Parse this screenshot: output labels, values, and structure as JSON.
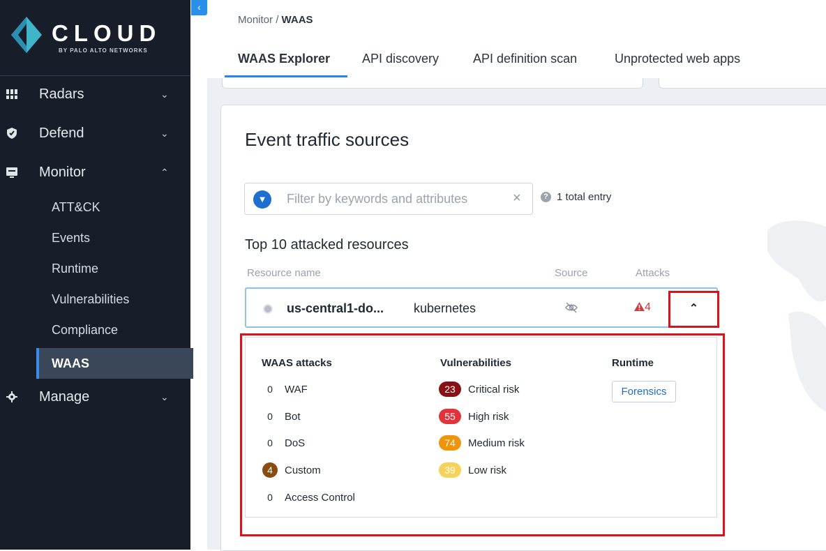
{
  "sidebar": {
    "logo_text": "CLOUD",
    "logo_sub": "BY PALO ALTO NETWORKS",
    "items": [
      {
        "label": "Radars",
        "icon": "radar-icon",
        "expanded": false
      },
      {
        "label": "Defend",
        "icon": "shield-icon",
        "expanded": false
      },
      {
        "label": "Monitor",
        "icon": "monitor-icon",
        "expanded": true
      },
      {
        "label": "Manage",
        "icon": "gear-icon",
        "expanded": false
      }
    ],
    "sub_items": [
      "ATT&CK",
      "Events",
      "Runtime",
      "Vulnerabilities",
      "Compliance",
      "WAAS"
    ],
    "active_sub": "WAAS"
  },
  "breadcrumb": {
    "parent": "Monitor",
    "separator": " / ",
    "current": "WAAS"
  },
  "tabs": [
    "WAAS Explorer",
    "API discovery",
    "API definition scan",
    "Unprotected web apps"
  ],
  "active_tab": "WAAS Explorer",
  "main": {
    "title": "Event traffic sources",
    "filter": {
      "placeholder": "Filter by keywords and attributes",
      "value": ""
    },
    "entry_count": "1 total entry",
    "section_title": "Top 10 attacked resources",
    "columns": [
      "Resource name",
      "Source",
      "Attacks"
    ],
    "resource": {
      "name": "us-central1-do...",
      "type": "kubernetes",
      "attacks": "4"
    },
    "details": {
      "waas_title": "WAAS attacks",
      "waas": [
        {
          "count": "0",
          "label": "WAF"
        },
        {
          "count": "0",
          "label": "Bot"
        },
        {
          "count": "0",
          "label": "DoS"
        },
        {
          "count": "4",
          "label": "Custom"
        },
        {
          "count": "0",
          "label": "Access Control"
        }
      ],
      "vuln_title": "Vulnerabilities",
      "vulns": [
        {
          "count": "23",
          "label": "Critical risk"
        },
        {
          "count": "55",
          "label": "High risk"
        },
        {
          "count": "74",
          "label": "Medium risk"
        },
        {
          "count": "39",
          "label": "Low risk"
        }
      ],
      "runtime_title": "Runtime",
      "forensics_label": "Forensics"
    }
  },
  "colors": {
    "sidebar_bg": "#171e2a",
    "accent": "#2a86e3",
    "highlight_red": "#d7141e",
    "critical": "#8a0f14",
    "high": "#e0343a",
    "medium": "#f0940a",
    "low": "#f7d25a"
  }
}
